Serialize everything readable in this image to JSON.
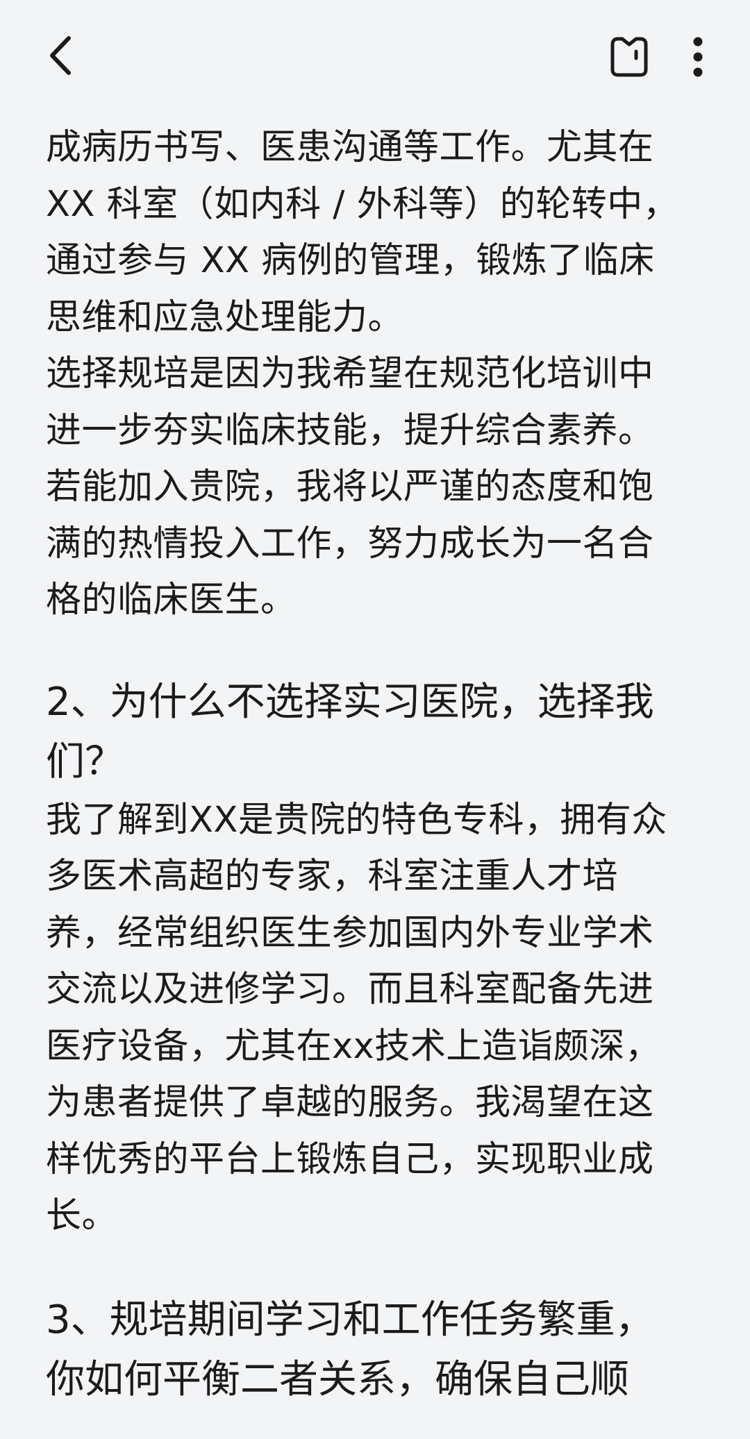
{
  "toolbar": {
    "back_icon": "chevron-left-icon",
    "save_icon": "bookmark-icon",
    "more_icon": "more-vertical-icon"
  },
  "article": {
    "p1": "成病历书写、医患沟通等工作。尤其在\nXX 科室（如内科 / 外科等）的轮转中，\n通过参与 XX 病例的管理，锻炼了临床\n思维和应急处理能力。",
    "p2": "选择规培是因为我希望在规范化培训中\n进一步夯实临床技能，提升综合素养。\n若能加入贵院，我将以严谨的态度和饱\n满的热情投入工作，努力成长为一名合\n格的临床医生。",
    "h2": "2、为什么不选择实习医院，选择我\n们？",
    "p3": "我了解到XX是贵院的特色专科，拥有众\n多医术高超的专家，科室注重人才培\n养，经常组织医生参加国内外专业学术\n交流以及进修学习。而且科室配备先进\n医疗设备，尤其在xx技术上造诣颇深，\n为患者提供了卓越的服务。我渴望在这\n样优秀的平台上锻炼自己，实现职业成\n长。",
    "h3": "3、规培期间学习和工作任务繁重，\n你如何平衡二者关系，确保自己顺"
  }
}
